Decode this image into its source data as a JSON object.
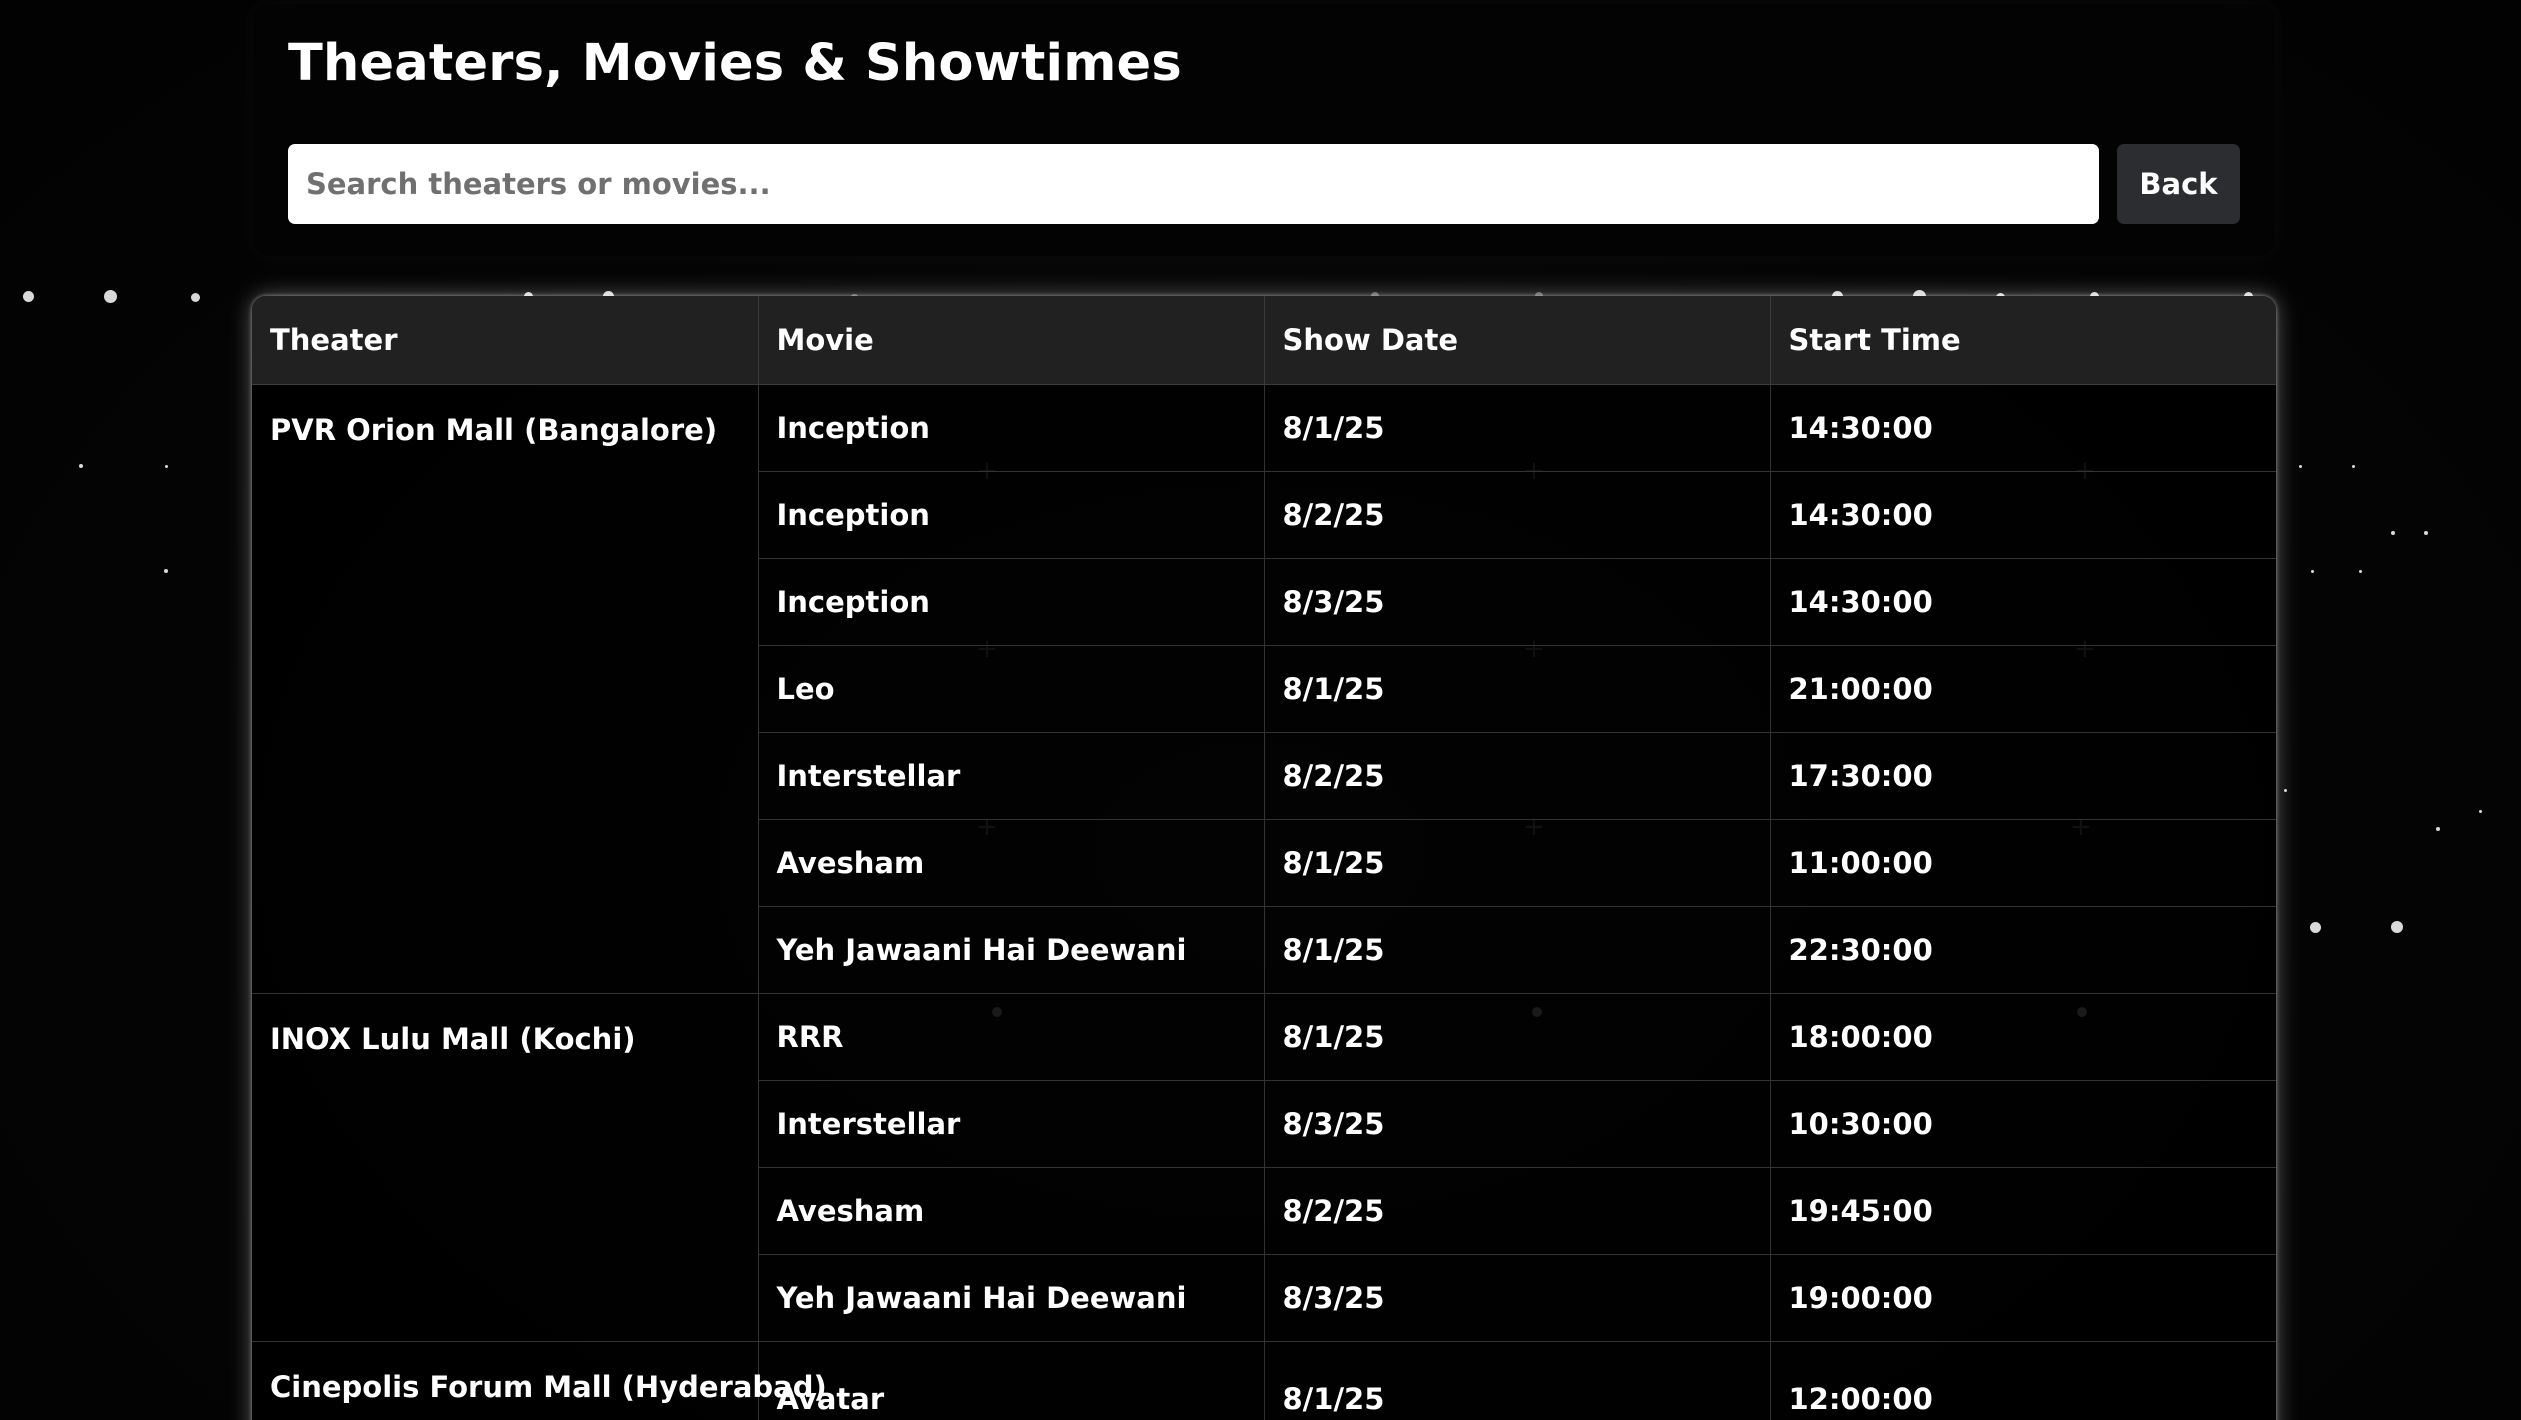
{
  "header": {
    "title": "Theaters, Movies & Showtimes",
    "search_placeholder": "Search theaters or movies...",
    "search_value": "",
    "back_label": "Back"
  },
  "table": {
    "columns": [
      "Theater",
      "Movie",
      "Show Date",
      "Start Time"
    ],
    "groups": [
      {
        "theater": "PVR Orion Mall (Bangalore)",
        "shows": [
          {
            "movie": "Inception",
            "date": "8/1/25",
            "time": "14:30:00"
          },
          {
            "movie": "Inception",
            "date": "8/2/25",
            "time": "14:30:00"
          },
          {
            "movie": "Inception",
            "date": "8/3/25",
            "time": "14:30:00"
          },
          {
            "movie": "Leo",
            "date": "8/1/25",
            "time": "21:00:00"
          },
          {
            "movie": "Interstellar",
            "date": "8/2/25",
            "time": "17:30:00"
          },
          {
            "movie": "Avesham",
            "date": "8/1/25",
            "time": "11:00:00"
          },
          {
            "movie": "Yeh Jawaani Hai Deewani",
            "date": "8/1/25",
            "time": "22:30:00"
          }
        ]
      },
      {
        "theater": "INOX Lulu Mall (Kochi)",
        "shows": [
          {
            "movie": "RRR",
            "date": "8/1/25",
            "time": "18:00:00"
          },
          {
            "movie": "Interstellar",
            "date": "8/3/25",
            "time": "10:30:00"
          },
          {
            "movie": "Avesham",
            "date": "8/2/25",
            "time": "19:45:00"
          },
          {
            "movie": "Yeh Jawaani Hai Deewani",
            "date": "8/3/25",
            "time": "19:00:00"
          }
        ]
      },
      {
        "theater": "Cinepolis Forum Mall (Hyderabad)",
        "shows": [
          {
            "movie": "Avatar",
            "date": "8/1/25",
            "time": "12:00:00"
          }
        ]
      }
    ]
  },
  "colors": {
    "background": "#040404",
    "header_row": "#212121",
    "back_button": "#2b2d30",
    "text": "#ffffff"
  }
}
